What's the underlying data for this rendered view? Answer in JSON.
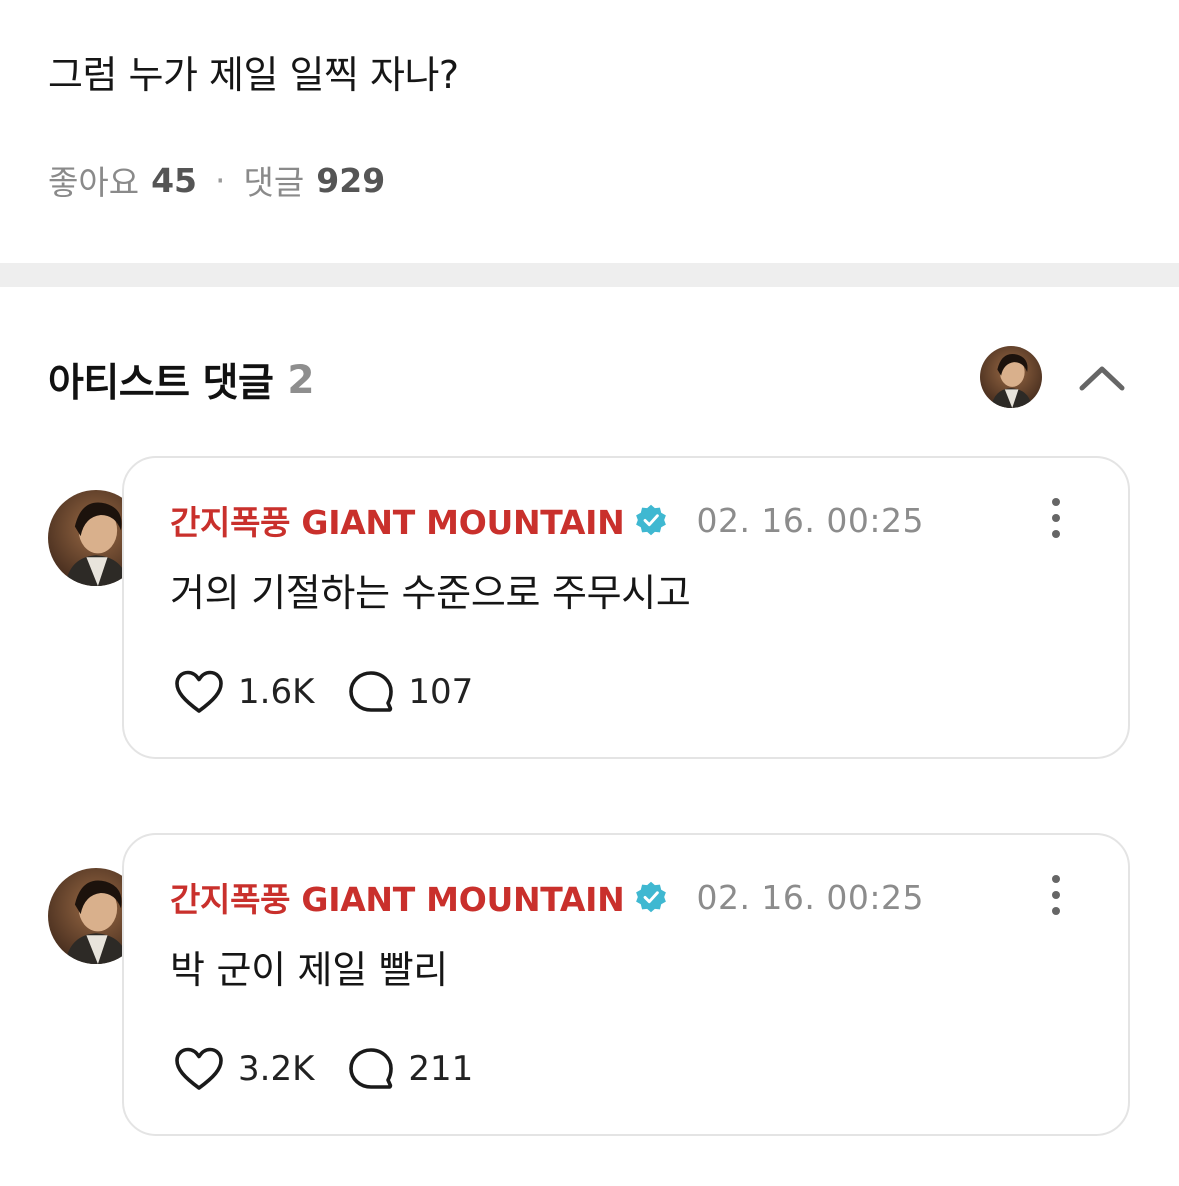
{
  "post": {
    "text": "그럼 누가 제일 일찍 자나?",
    "likes_label": "좋아요",
    "likes_count": "45",
    "separator": "·",
    "comments_label": "댓글",
    "comments_count": "929"
  },
  "artist_comments": {
    "title": "아티스트 댓글",
    "count": "2",
    "header_avatar_icon": "artist-avatar",
    "collapse_icon": "chevron-up-icon"
  },
  "comments": [
    {
      "author": "간지폭풍 GIANT MOUNTAIN",
      "verified_icon": "verified-badge-icon",
      "timestamp": "02. 16. 00:25",
      "text": "거의 기절하는 수준으로 주무시고",
      "likes": "1.6K",
      "replies": "107"
    },
    {
      "author": "간지폭풍 GIANT MOUNTAIN",
      "verified_icon": "verified-badge-icon",
      "timestamp": "02. 16. 00:25",
      "text": "박 군이 제일 빨리",
      "likes": "3.2K",
      "replies": "211"
    }
  ],
  "colors": {
    "author": "#c9302c",
    "verified": "#3fb8d1",
    "muted": "#8c8c8c",
    "divider": "#eeeeee",
    "card_border": "#e4e4e4"
  }
}
